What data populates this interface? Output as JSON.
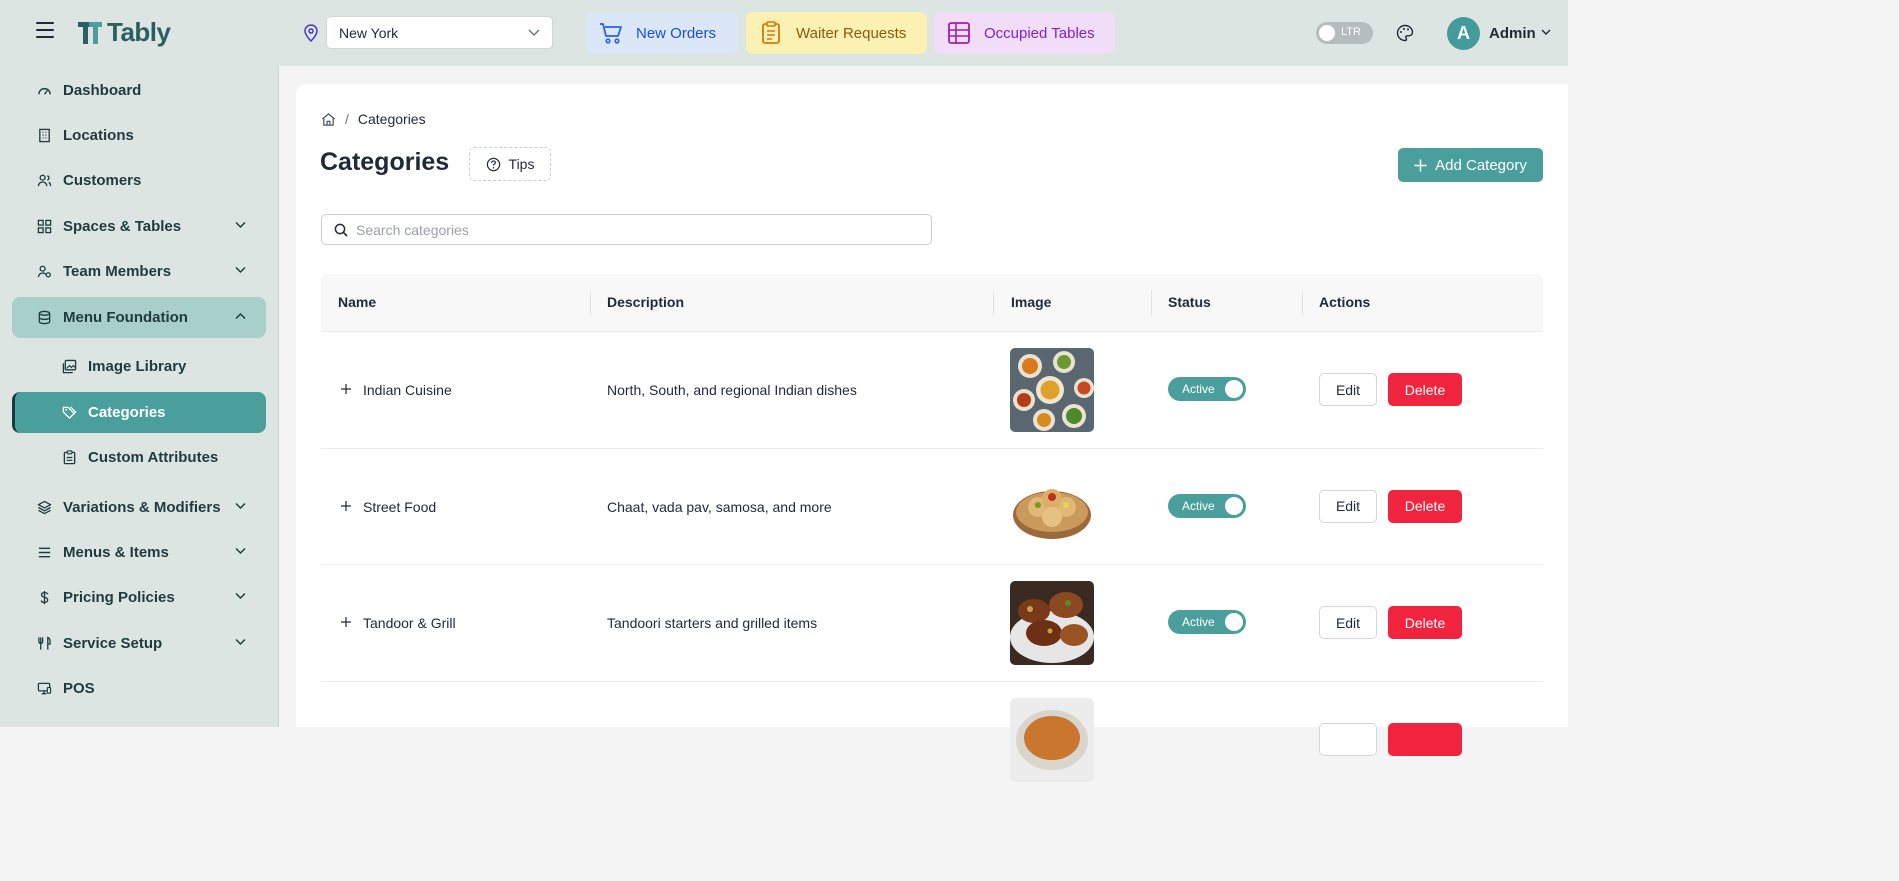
{
  "app": {
    "name": "Tably"
  },
  "header": {
    "location": "New York",
    "quick_actions": {
      "new_orders": "New Orders",
      "waiter_requests": "Waiter Requests",
      "occupied_tables": "Occupied Tables"
    },
    "direction_toggle": "LTR",
    "user": {
      "initial": "A",
      "name": "Admin"
    }
  },
  "sidebar": {
    "items": [
      {
        "label": "Dashboard",
        "icon": "gauge-icon"
      },
      {
        "label": "Locations",
        "icon": "building-icon"
      },
      {
        "label": "Customers",
        "icon": "users-icon"
      },
      {
        "label": "Spaces & Tables",
        "icon": "grid-icon",
        "has_children": true
      },
      {
        "label": "Team Members",
        "icon": "team-icon",
        "has_children": true
      },
      {
        "label": "Menu Foundation",
        "icon": "database-icon",
        "expanded": true
      },
      {
        "label": "Image Library",
        "icon": "images-icon",
        "sub": true
      },
      {
        "label": "Categories",
        "icon": "tags-icon",
        "sub": true,
        "active": true
      },
      {
        "label": "Custom Attributes",
        "icon": "clipboard-icon",
        "sub": true
      },
      {
        "label": "Variations & Modifiers",
        "icon": "layers-icon",
        "has_children": true
      },
      {
        "label": "Menus & Items",
        "icon": "list-icon",
        "has_children": true
      },
      {
        "label": "Pricing Policies",
        "icon": "dollar-icon",
        "has_children": true
      },
      {
        "label": "Service Setup",
        "icon": "utensils-icon",
        "has_children": true
      },
      {
        "label": "POS",
        "icon": "pos-icon"
      }
    ]
  },
  "main": {
    "breadcrumb": {
      "current": "Categories",
      "separator": "/"
    },
    "title": "Categories",
    "tips_label": "Tips",
    "add_label": "Add Category",
    "search_placeholder": "Search categories",
    "columns": {
      "name": "Name",
      "description": "Description",
      "image": "Image",
      "status": "Status",
      "actions": "Actions"
    },
    "rows": [
      {
        "name": "Indian Cuisine",
        "description": "North, South, and regional Indian dishes",
        "status": "Active",
        "image": "indian-cuisine-thumbnail",
        "edit": "Edit",
        "delete": "Delete"
      },
      {
        "name": "Street Food",
        "description": "Chaat, vada pav, samosa, and more",
        "status": "Active",
        "image": "street-food-thumbnail",
        "edit": "Edit",
        "delete": "Delete"
      },
      {
        "name": "Tandoor & Grill",
        "description": "Tandoori starters and grilled items",
        "status": "Active",
        "image": "tandoor-grill-thumbnail",
        "edit": "Edit",
        "delete": "Delete"
      }
    ]
  },
  "colors": {
    "brand": "#4a9f9c",
    "danger": "#f0243f",
    "sidebar_bg": "#dde5e3"
  }
}
